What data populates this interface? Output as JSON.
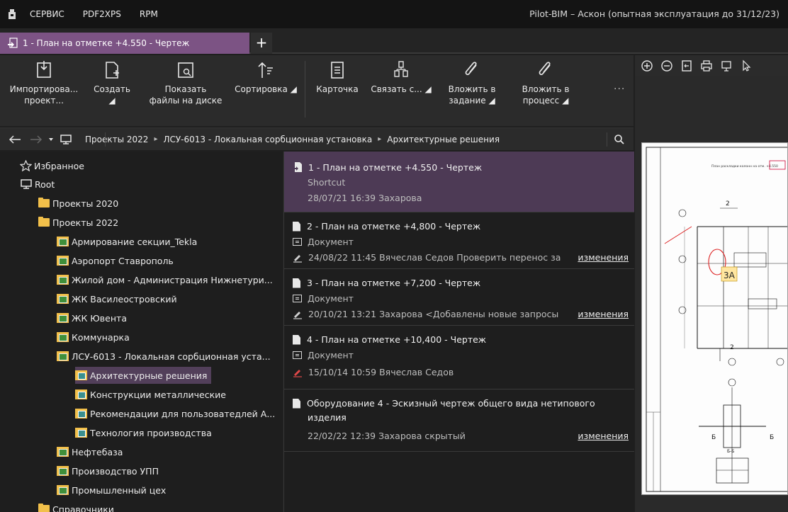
{
  "app": {
    "menu": [
      "СЕРВИС",
      "PDF2XPS",
      "RPM"
    ],
    "window_title": "Pilot-BIM – Аскон (опытная эксплуатация до 31/12/23)"
  },
  "tab": {
    "label": "1 - План на отметке +4.550 - Чертеж",
    "new_tab": "+"
  },
  "ribbon": {
    "import": "Импортирова... проект...",
    "import_l1": "Импортирова...",
    "import_l2": "проект...",
    "create": "Создать ◢",
    "show_l1": "Показать",
    "show_l2": "файлы на диске",
    "sort": "Сортировка ◢",
    "card": "Карточка",
    "link": "Связать с... ◢",
    "attach_task_l1": "Вложить в",
    "attach_task_l2": "задание ◢",
    "attach_process_l1": "Вложить в",
    "attach_process_l2": "процесс ◢",
    "more": "..."
  },
  "breadcrumb": {
    "items": [
      "Проекты 2022",
      "ЛСУ-6013 - Локальная сорбционная установка",
      "Архитектурные решения"
    ],
    "sep": "▸"
  },
  "tree": {
    "favorites": "Избранное",
    "root": "Root",
    "projects_2020": "Проекты 2020",
    "projects_2022": "Проекты 2022",
    "p1": "Армирование секции_Tekla",
    "p2": "Аэропорт Ставрополь",
    "p3": "Жилой дом - Администрация Нижнетури...",
    "p4": "ЖК Василеостровский",
    "p5": "ЖК Ювента",
    "p6": "Коммунарка",
    "p7": "ЛСУ-6013 - Локальная сорбционная уста...",
    "s1": "Архитектурные решения",
    "s2": "Конструкции металлические",
    "s3": "Рекомендации для пользоватедлей А...",
    "s4": "Технология производства",
    "p8": "Нефтебаза",
    "p9": "Производство УПП",
    "p10": "Промышленный цех",
    "p11": "Справочники"
  },
  "list": {
    "items": [
      {
        "title": "1 - План на отметке +4.550 - Чертеж",
        "type": "Shortcut",
        "meta": "28/07/21 16:39 Захарова"
      },
      {
        "title": "2 - План на отметке +4,800 - Чертеж",
        "type": "Документ",
        "meta": "24/08/22 11:45 Вячеслав Седов Проверить перенос за",
        "link": "изменения"
      },
      {
        "title": "3 - План на отметке +7,200 - Чертеж",
        "type": "Документ",
        "meta": "20/10/21 13:21 Захарова <Добавлены новые запросы",
        "link": "изменения"
      },
      {
        "title": "4 - План на отметке +10,400 - Чертеж",
        "type": "Документ",
        "meta": "15/10/14 10:59 Вячеслав Седов"
      },
      {
        "title_l1": "Оборудование 4 - Эскизный чертеж общего вида нетипового",
        "title_l2": "изделия",
        "meta": "22/02/22 12:39 Захарова скрытый",
        "link": "изменения"
      }
    ]
  },
  "preview": {
    "annotation": "3A",
    "sheet_heading": "План раскладки колонн на отм. +4.550",
    "axis_2": "2",
    "axis_1": "1",
    "label_b": "Б",
    "section": "Б-Б"
  },
  "colors": {
    "accent": "#7c5384",
    "selected_row": "#4d3a55",
    "folder": "#f2c04a"
  }
}
